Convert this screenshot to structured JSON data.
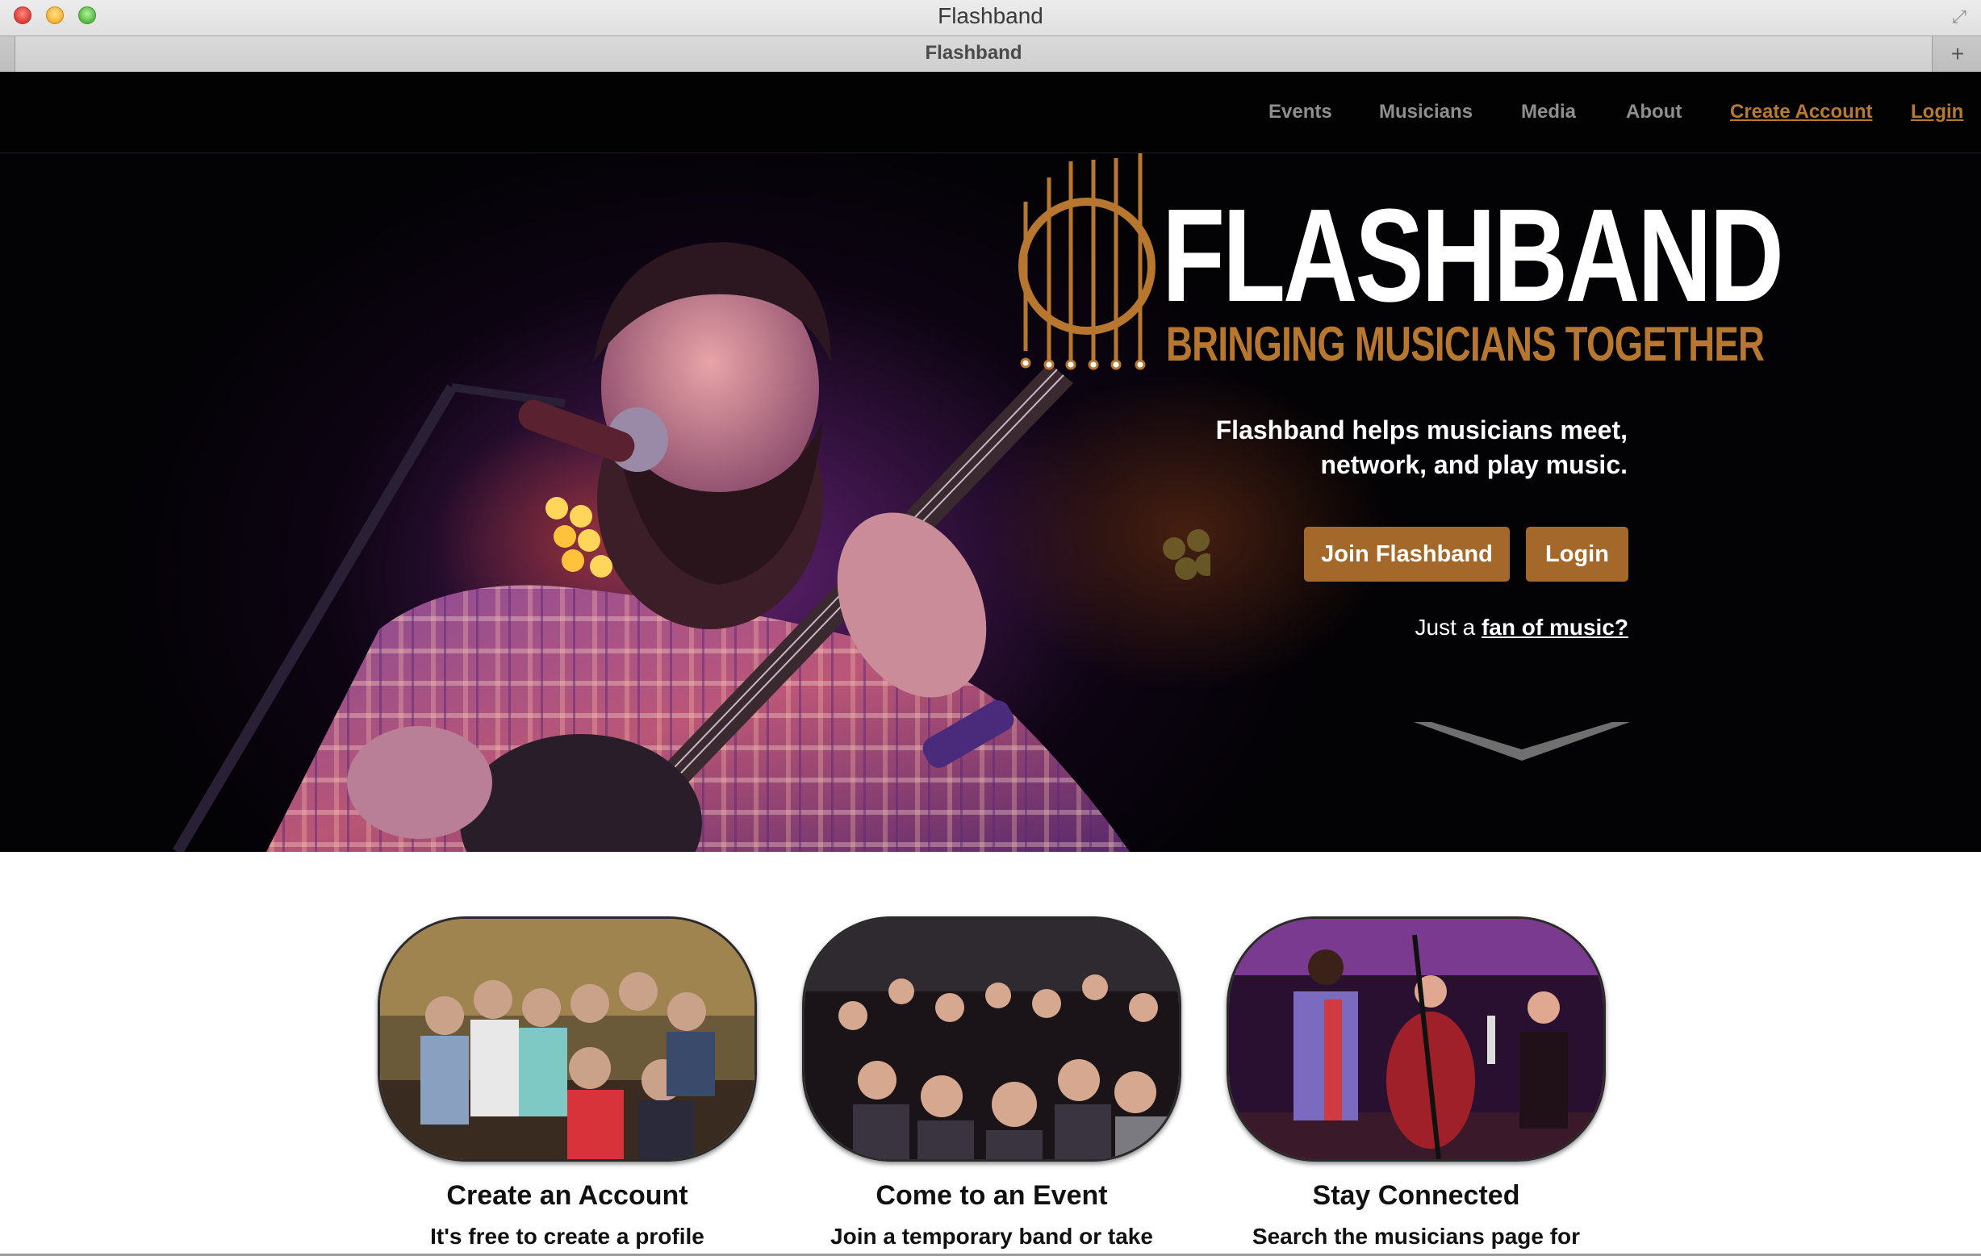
{
  "window": {
    "title": "Flashband",
    "tab_title": "Flashband",
    "new_tab_symbol": "+"
  },
  "nav": {
    "items": [
      "Events",
      "Musicians",
      "Media",
      "About"
    ],
    "create_account": "Create Account",
    "login": "Login"
  },
  "hero": {
    "logo_name": "FLASHBAND",
    "logo_tagline": "BRINGING MUSICIANS TOGETHER",
    "description_line1": "Flashband helps musicians meet,",
    "description_line2": "network, and play music.",
    "join_button": "Join Flashband",
    "login_button": "Login",
    "fan_prefix": "Just a ",
    "fan_link": "fan of music?"
  },
  "features": [
    {
      "title": "Create an Account",
      "text": "It's free to create a profile"
    },
    {
      "title": "Come to an Event",
      "text": "Join a temporary band or take"
    },
    {
      "title": "Stay Connected",
      "text": "Search the musicians page for"
    }
  ],
  "colors": {
    "accent": "#a4692a",
    "nav_link": "#8e8e8e",
    "logo_orange": "#b8772e",
    "hero_bg": "#030205"
  },
  "icons": [
    "close-window-icon",
    "minimize-window-icon",
    "zoom-window-icon",
    "fullscreen-icon",
    "new-tab-icon",
    "scroll-down-chevron-icon",
    "guitar-logo-icon"
  ]
}
